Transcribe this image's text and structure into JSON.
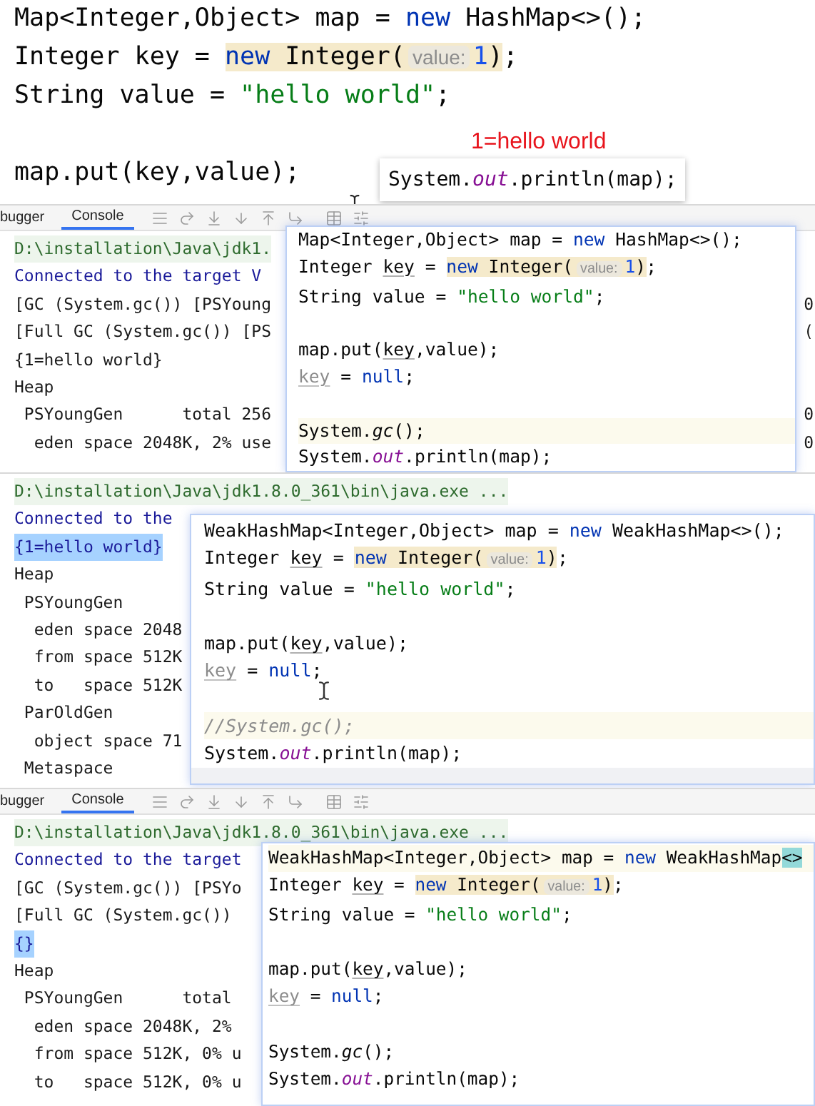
{
  "editor": {
    "lines": [
      {
        "kind": "code",
        "tokens": [
          {
            "text": "Map<Integer,Object> map = ",
            "kind": "plain"
          },
          {
            "text": "new",
            "kind": "keyword"
          },
          {
            "text": " HashMap<>();",
            "kind": "plain"
          }
        ]
      },
      {
        "kind": "code",
        "tokens": [
          {
            "text": "Integer key = ",
            "kind": "plain"
          },
          {
            "kind": "mark",
            "children": [
              {
                "text": "new",
                "kind": "keyword"
              },
              {
                "text": " Integer(",
                "kind": "plain"
              },
              {
                "text": "value:",
                "kind": "hint"
              },
              {
                "text": "1",
                "kind": "number"
              },
              {
                "text": ")",
                "kind": "plain"
              }
            ]
          },
          {
            "text": ";",
            "kind": "plain"
          }
        ]
      },
      {
        "kind": "code",
        "tokens": [
          {
            "text": "String value = ",
            "kind": "plain"
          },
          {
            "text": "\"hello world\"",
            "kind": "string"
          },
          {
            "text": ";",
            "kind": "plain"
          }
        ]
      },
      {
        "kind": "blank"
      },
      {
        "kind": "code",
        "tokens": [
          {
            "text": "map.put(key,value);",
            "kind": "plain"
          }
        ]
      }
    ]
  },
  "annotation": "1=hello world",
  "tooltip": {
    "tokens": [
      {
        "text": "System.",
        "kind": "plain"
      },
      {
        "text": "out",
        "kind": "field"
      },
      {
        "text": ".println(map);",
        "kind": "plain"
      }
    ]
  },
  "panels": [
    {
      "toolbar": {
        "tabs": [
          {
            "label": "bugger",
            "selected": false
          },
          {
            "label": "Console",
            "selected": true
          }
        ]
      },
      "console": [
        {
          "text": "D:\\installation\\Java\\jdk1.",
          "kind": "path"
        },
        {
          "text": "Connected to the target V",
          "kind": "info"
        },
        {
          "text": "[GC (System.gc()) [PSYoung",
          "kind": "output",
          "tail": "0"
        },
        {
          "text": "[Full GC (System.gc()) [PS",
          "kind": "output",
          "tail": "("
        },
        {
          "text": "{1=hello world}",
          "kind": "output"
        },
        {
          "text": "Heap",
          "kind": "output"
        },
        {
          "text": " PSYoungGen      total 256",
          "kind": "output",
          "tail": "0"
        },
        {
          "text": "  eden space 2048K, 2% use",
          "kind": "output",
          "tail": "0"
        }
      ],
      "popup": {
        "lines": [
          {
            "kind": "code",
            "highlighted": false,
            "tokens": [
              {
                "text": "Map<Integer,Object> map = ",
                "kind": "plain"
              },
              {
                "text": "new",
                "kind": "keyword"
              },
              {
                "text": " HashMap<>();",
                "kind": "plain"
              }
            ]
          },
          {
            "kind": "code",
            "highlighted": false,
            "tokens": [
              {
                "text": "Integer ",
                "kind": "plain"
              },
              {
                "text": "key",
                "kind": "ref"
              },
              {
                "text": " = ",
                "kind": "plain"
              },
              {
                "kind": "mark",
                "children": [
                  {
                    "text": "new",
                    "kind": "keyword"
                  },
                  {
                    "text": " Integer(",
                    "kind": "plain"
                  },
                  {
                    "text": "value:",
                    "kind": "hint"
                  },
                  {
                    "text": "1",
                    "kind": "number"
                  },
                  {
                    "text": ")",
                    "kind": "plain"
                  }
                ]
              },
              {
                "text": ";",
                "kind": "plain"
              }
            ]
          },
          {
            "kind": "code",
            "highlighted": false,
            "tokens": [
              {
                "text": "String value = ",
                "kind": "plain"
              },
              {
                "text": "\"hello world\"",
                "kind": "string"
              },
              {
                "text": ";",
                "kind": "plain"
              }
            ]
          },
          {
            "kind": "blank",
            "highlighted": false
          },
          {
            "kind": "code",
            "highlighted": false,
            "tokens": [
              {
                "text": "map.put(",
                "kind": "plain"
              },
              {
                "text": "key",
                "kind": "ref"
              },
              {
                "text": ",value);",
                "kind": "plain"
              }
            ]
          },
          {
            "kind": "code",
            "highlighted": false,
            "tokens": [
              {
                "text": "key",
                "kind": "unused"
              },
              {
                "text": " = ",
                "kind": "plain"
              },
              {
                "text": "null",
                "kind": "keyword"
              },
              {
                "text": ";",
                "kind": "plain"
              }
            ]
          },
          {
            "kind": "blank",
            "highlighted": false
          },
          {
            "kind": "code",
            "highlighted": true,
            "tokens": [
              {
                "text": "System.",
                "kind": "plain"
              },
              {
                "text": "gc",
                "kind": "italic"
              },
              {
                "text": "();",
                "kind": "plain"
              }
            ]
          },
          {
            "kind": "code",
            "highlighted": false,
            "tokens": [
              {
                "text": "System.",
                "kind": "plain"
              },
              {
                "text": "out",
                "kind": "field"
              },
              {
                "text": ".println(map);",
                "kind": "plain"
              }
            ]
          }
        ]
      }
    },
    {
      "console": [
        {
          "text": "D:\\installation\\Java\\jdk1.8.0_361\\bin\\java.exe ...",
          "kind": "path"
        },
        {
          "text": "Connected to the",
          "kind": "info"
        },
        {
          "text": "{1=hello world}",
          "kind": "selected"
        },
        {
          "text": "Heap",
          "kind": "output"
        },
        {
          "text": " PSYoungGen",
          "kind": "output"
        },
        {
          "text": "  eden space 2048",
          "kind": "output"
        },
        {
          "text": "  from space 512K",
          "kind": "output"
        },
        {
          "text": "  to   space 512K",
          "kind": "output"
        },
        {
          "text": " ParOldGen",
          "kind": "output"
        },
        {
          "text": "  object space 71",
          "kind": "output"
        },
        {
          "text": " Metaspace",
          "kind": "output"
        }
      ],
      "popup": {
        "lines": [
          {
            "kind": "code",
            "highlighted": false,
            "tokens": [
              {
                "text": "WeakHashMap<Integer,Object> map = ",
                "kind": "plain"
              },
              {
                "text": "new",
                "kind": "keyword"
              },
              {
                "text": " WeakHashMap<>();",
                "kind": "plain"
              }
            ]
          },
          {
            "kind": "code",
            "highlighted": false,
            "tokens": [
              {
                "text": "Integer ",
                "kind": "plain"
              },
              {
                "text": "key",
                "kind": "ref"
              },
              {
                "text": " = ",
                "kind": "plain"
              },
              {
                "kind": "mark",
                "children": [
                  {
                    "text": "new",
                    "kind": "keyword"
                  },
                  {
                    "text": " Integer(",
                    "kind": "plain"
                  },
                  {
                    "text": "value:",
                    "kind": "hint"
                  },
                  {
                    "text": "1",
                    "kind": "number"
                  },
                  {
                    "text": ")",
                    "kind": "plain"
                  }
                ]
              },
              {
                "text": ";",
                "kind": "plain"
              }
            ]
          },
          {
            "kind": "code",
            "highlighted": false,
            "tokens": [
              {
                "text": "String value = ",
                "kind": "plain"
              },
              {
                "text": "\"hello world\"",
                "kind": "string"
              },
              {
                "text": ";",
                "kind": "plain"
              }
            ]
          },
          {
            "kind": "blank",
            "highlighted": false
          },
          {
            "kind": "code",
            "highlighted": false,
            "tokens": [
              {
                "text": "map.put(",
                "kind": "plain"
              },
              {
                "text": "key",
                "kind": "ref"
              },
              {
                "text": ",value);",
                "kind": "plain"
              }
            ]
          },
          {
            "kind": "code",
            "highlighted": false,
            "tokens": [
              {
                "text": "key",
                "kind": "unused"
              },
              {
                "text": " = ",
                "kind": "plain"
              },
              {
                "text": "null",
                "kind": "keyword"
              },
              {
                "text": ";",
                "kind": "plain"
              }
            ]
          },
          {
            "kind": "blank",
            "highlighted": false
          },
          {
            "kind": "code",
            "highlighted": true,
            "tokens": [
              {
                "text": "//System.gc();",
                "kind": "comment"
              }
            ]
          },
          {
            "kind": "code",
            "highlighted": false,
            "tokens": [
              {
                "text": "System.",
                "kind": "plain"
              },
              {
                "text": "out",
                "kind": "field"
              },
              {
                "text": ".println(map);",
                "kind": "plain"
              }
            ]
          }
        ]
      }
    },
    {
      "toolbar": {
        "tabs": [
          {
            "label": "bugger",
            "selected": false
          },
          {
            "label": "Console",
            "selected": true
          }
        ]
      },
      "console": [
        {
          "text": "D:\\installation\\Java\\jdk1.8.0_361\\bin\\java.exe ...",
          "kind": "path"
        },
        {
          "text": "Connected to the target",
          "kind": "info"
        },
        {
          "text": "[GC (System.gc()) [PSYo",
          "kind": "output"
        },
        {
          "text": "[Full GC (System.gc())",
          "kind": "output"
        },
        {
          "text": "{}",
          "kind": "selected"
        },
        {
          "text": "Heap",
          "kind": "output"
        },
        {
          "text": " PSYoungGen      total",
          "kind": "output"
        },
        {
          "text": "  eden space 2048K, 2%",
          "kind": "output"
        },
        {
          "text": "  from space 512K, 0% u",
          "kind": "output"
        },
        {
          "text": "  to   space 512K, 0% u",
          "kind": "output"
        }
      ],
      "popup": {
        "lines": [
          {
            "kind": "code",
            "highlighted": true,
            "tokens": [
              {
                "text": "WeakHashMap<Integer,Object> map = ",
                "kind": "plain"
              },
              {
                "text": "new",
                "kind": "keyword"
              },
              {
                "text": " WeakHashMap",
                "kind": "plain"
              },
              {
                "text": "<>",
                "kind": "brace"
              }
            ]
          },
          {
            "kind": "code",
            "highlighted": false,
            "tokens": [
              {
                "text": "Integer ",
                "kind": "plain"
              },
              {
                "text": "key",
                "kind": "ref"
              },
              {
                "text": " = ",
                "kind": "plain"
              },
              {
                "kind": "mark",
                "children": [
                  {
                    "text": "new",
                    "kind": "keyword"
                  },
                  {
                    "text": " Integer(",
                    "kind": "plain"
                  },
                  {
                    "text": "value:",
                    "kind": "hint"
                  },
                  {
                    "text": "1",
                    "kind": "number"
                  },
                  {
                    "text": ")",
                    "kind": "plain"
                  }
                ]
              },
              {
                "text": ";",
                "kind": "plain"
              }
            ]
          },
          {
            "kind": "code",
            "highlighted": false,
            "tokens": [
              {
                "text": "String value = ",
                "kind": "plain"
              },
              {
                "text": "\"hello world\"",
                "kind": "string"
              },
              {
                "text": ";",
                "kind": "plain"
              }
            ]
          },
          {
            "kind": "blank",
            "highlighted": false
          },
          {
            "kind": "code",
            "highlighted": false,
            "tokens": [
              {
                "text": "map.put(",
                "kind": "plain"
              },
              {
                "text": "key",
                "kind": "ref"
              },
              {
                "text": ",value);",
                "kind": "plain"
              }
            ]
          },
          {
            "kind": "code",
            "highlighted": false,
            "tokens": [
              {
                "text": "key",
                "kind": "unused"
              },
              {
                "text": " = ",
                "kind": "plain"
              },
              {
                "text": "null",
                "kind": "keyword"
              },
              {
                "text": ";",
                "kind": "plain"
              }
            ]
          },
          {
            "kind": "blank",
            "highlighted": false
          },
          {
            "kind": "code",
            "highlighted": false,
            "tokens": [
              {
                "text": "System.",
                "kind": "plain"
              },
              {
                "text": "gc",
                "kind": "italic"
              },
              {
                "text": "();",
                "kind": "plain"
              }
            ]
          },
          {
            "kind": "code",
            "highlighted": false,
            "tokens": [
              {
                "text": "System.",
                "kind": "plain"
              },
              {
                "text": "out",
                "kind": "field"
              },
              {
                "text": ".println(map);",
                "kind": "plain"
              }
            ]
          }
        ]
      }
    }
  ]
}
